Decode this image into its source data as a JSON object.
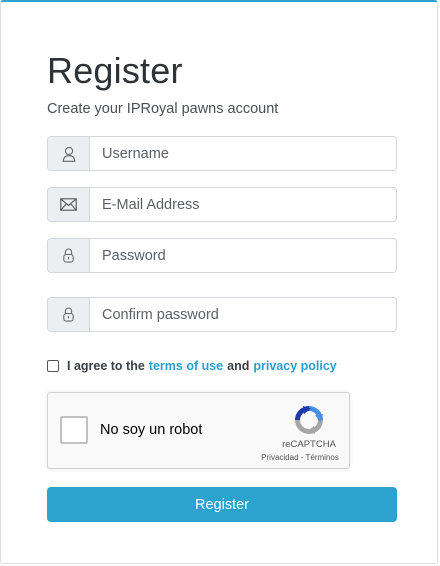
{
  "form": {
    "title": "Register",
    "subtitle": "Create your IPRoyal pawns account"
  },
  "fields": {
    "username": {
      "icon": "user-icon",
      "placeholder": "Username",
      "value": ""
    },
    "email": {
      "icon": "envelope-icon",
      "placeholder": "E-Mail Address",
      "value": ""
    },
    "password": {
      "icon": "lock-icon",
      "placeholder": "Password",
      "value": ""
    },
    "confirm_password": {
      "icon": "lock-icon",
      "placeholder": "Confirm password",
      "value": ""
    }
  },
  "agreement": {
    "checked": false,
    "prefix": "I agree to the",
    "terms_link": "terms of use",
    "conjunction": "and",
    "privacy_link": "privacy policy"
  },
  "recaptcha": {
    "label": "No soy un robot",
    "brand": "reCAPTCHA",
    "links": "Privacidad - Términos",
    "icon": "recaptcha-logo-icon"
  },
  "submit": {
    "label": "Register"
  },
  "colors": {
    "accent": "#2ca3cf",
    "link": "#2a9fd0",
    "addon_bg": "#eceef1",
    "border": "#d3d7dc"
  }
}
